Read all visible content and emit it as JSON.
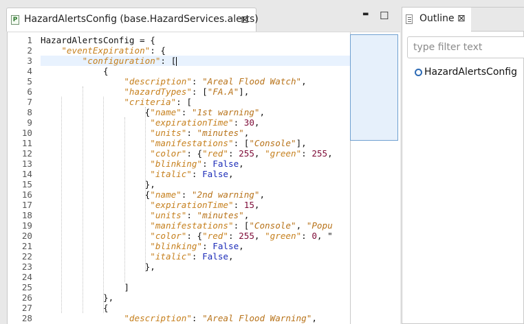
{
  "editor": {
    "tab_title": "HazardAlertsConfig (base.HazardServices.alerts)",
    "tab_close_glyph": "⊠",
    "file_icon_letter": "P",
    "minimize_glyph": "▬",
    "maximize_glyph": "☐",
    "current_line": 3,
    "lines": [
      {
        "num": "1",
        "parts": [
          [
            "p",
            "HazardAlertsConfig = {"
          ]
        ]
      },
      {
        "num": "2",
        "parts": [
          [
            "p",
            "    "
          ],
          [
            "k",
            "\"eventExpiration\""
          ],
          [
            "p",
            ": {"
          ]
        ]
      },
      {
        "num": "3",
        "parts": [
          [
            "p",
            "        "
          ],
          [
            "k",
            "\"configuration\""
          ],
          [
            "p",
            ": ["
          ]
        ]
      },
      {
        "num": "4",
        "parts": [
          [
            "p",
            "            {"
          ]
        ]
      },
      {
        "num": "5",
        "parts": [
          [
            "p",
            "                "
          ],
          [
            "k",
            "\"description\""
          ],
          [
            "p",
            ": "
          ],
          [
            "s",
            "\"Areal Flood Watch\""
          ],
          [
            "p",
            ","
          ]
        ]
      },
      {
        "num": "6",
        "parts": [
          [
            "p",
            "                "
          ],
          [
            "k",
            "\"hazardTypes\""
          ],
          [
            "p",
            ": ["
          ],
          [
            "s",
            "\"FA.A\""
          ],
          [
            "p",
            "],"
          ]
        ]
      },
      {
        "num": "7",
        "parts": [
          [
            "p",
            "                "
          ],
          [
            "k",
            "\"criteria\""
          ],
          [
            "p",
            ": ["
          ]
        ]
      },
      {
        "num": "8",
        "parts": [
          [
            "p",
            "                    {"
          ],
          [
            "k",
            "\"name\""
          ],
          [
            "p",
            ": "
          ],
          [
            "s",
            "\"1st warning\""
          ],
          [
            "p",
            ","
          ]
        ]
      },
      {
        "num": "9",
        "parts": [
          [
            "p",
            "                     "
          ],
          [
            "k",
            "\"expirationTime\""
          ],
          [
            "p",
            ": "
          ],
          [
            "n",
            "30"
          ],
          [
            "p",
            ","
          ]
        ]
      },
      {
        "num": "10",
        "parts": [
          [
            "p",
            "                     "
          ],
          [
            "k",
            "\"units\""
          ],
          [
            "p",
            ": "
          ],
          [
            "s",
            "\"minutes\""
          ],
          [
            "p",
            ","
          ]
        ]
      },
      {
        "num": "11",
        "parts": [
          [
            "p",
            "                     "
          ],
          [
            "k",
            "\"manifestations\""
          ],
          [
            "p",
            ": ["
          ],
          [
            "s",
            "\"Console\""
          ],
          [
            "p",
            "],"
          ]
        ]
      },
      {
        "num": "12",
        "parts": [
          [
            "p",
            "                     "
          ],
          [
            "k",
            "\"color\""
          ],
          [
            "p",
            ": {"
          ],
          [
            "k",
            "\"red\""
          ],
          [
            "p",
            ": "
          ],
          [
            "n",
            "255"
          ],
          [
            "p",
            ", "
          ],
          [
            "k",
            "\"green\""
          ],
          [
            "p",
            ": "
          ],
          [
            "n",
            "255"
          ],
          [
            "p",
            ","
          ]
        ]
      },
      {
        "num": "13",
        "parts": [
          [
            "p",
            "                     "
          ],
          [
            "k",
            "\"blinking\""
          ],
          [
            "p",
            ": "
          ],
          [
            "b",
            "False"
          ],
          [
            "p",
            ","
          ]
        ]
      },
      {
        "num": "14",
        "parts": [
          [
            "p",
            "                     "
          ],
          [
            "k",
            "\"italic\""
          ],
          [
            "p",
            ": "
          ],
          [
            "b",
            "False"
          ],
          [
            "p",
            ","
          ]
        ]
      },
      {
        "num": "15",
        "parts": [
          [
            "p",
            "                    },"
          ]
        ]
      },
      {
        "num": "16",
        "parts": [
          [
            "p",
            "                    {"
          ],
          [
            "k",
            "\"name\""
          ],
          [
            "p",
            ": "
          ],
          [
            "s",
            "\"2nd warning\""
          ],
          [
            "p",
            ","
          ]
        ]
      },
      {
        "num": "17",
        "parts": [
          [
            "p",
            "                     "
          ],
          [
            "k",
            "\"expirationTime\""
          ],
          [
            "p",
            ": "
          ],
          [
            "n",
            "15"
          ],
          [
            "p",
            ","
          ]
        ]
      },
      {
        "num": "18",
        "parts": [
          [
            "p",
            "                     "
          ],
          [
            "k",
            "\"units\""
          ],
          [
            "p",
            ": "
          ],
          [
            "s",
            "\"minutes\""
          ],
          [
            "p",
            ","
          ]
        ]
      },
      {
        "num": "19",
        "parts": [
          [
            "p",
            "                     "
          ],
          [
            "k",
            "\"manifestations\""
          ],
          [
            "p",
            ": ["
          ],
          [
            "s",
            "\"Console\""
          ],
          [
            "p",
            ", "
          ],
          [
            "s",
            "\"Popu"
          ]
        ]
      },
      {
        "num": "20",
        "parts": [
          [
            "p",
            "                     "
          ],
          [
            "k",
            "\"color\""
          ],
          [
            "p",
            ": {"
          ],
          [
            "k",
            "\"red\""
          ],
          [
            "p",
            ": "
          ],
          [
            "n",
            "255"
          ],
          [
            "p",
            ", "
          ],
          [
            "k",
            "\"green\""
          ],
          [
            "p",
            ": "
          ],
          [
            "n",
            "0"
          ],
          [
            "p",
            ", \""
          ]
        ]
      },
      {
        "num": "21",
        "parts": [
          [
            "p",
            "                     "
          ],
          [
            "k",
            "\"blinking\""
          ],
          [
            "p",
            ": "
          ],
          [
            "b",
            "False"
          ],
          [
            "p",
            ","
          ]
        ]
      },
      {
        "num": "22",
        "parts": [
          [
            "p",
            "                     "
          ],
          [
            "k",
            "\"italic\""
          ],
          [
            "p",
            ": "
          ],
          [
            "b",
            "False"
          ],
          [
            "p",
            ","
          ]
        ]
      },
      {
        "num": "23",
        "parts": [
          [
            "p",
            "                    },"
          ]
        ]
      },
      {
        "num": "24",
        "parts": [
          [
            "p",
            ""
          ]
        ]
      },
      {
        "num": "25",
        "parts": [
          [
            "p",
            "                ]"
          ]
        ]
      },
      {
        "num": "26",
        "parts": [
          [
            "p",
            "            },"
          ]
        ]
      },
      {
        "num": "27",
        "parts": [
          [
            "p",
            "            {"
          ]
        ]
      },
      {
        "num": "28",
        "parts": [
          [
            "p",
            "                "
          ],
          [
            "k",
            "\"description\""
          ],
          [
            "p",
            ": "
          ],
          [
            "s",
            "\"Areal Flood Warning\""
          ],
          [
            "p",
            ","
          ]
        ]
      }
    ]
  },
  "outline": {
    "tab_title": "Outline",
    "tab_close_glyph": "⊠",
    "filter_placeholder": "type filter text",
    "filter_value": "",
    "items": [
      "HazardAlertsConfig"
    ]
  },
  "colors": {
    "key": "#c6801e",
    "string": "#b8731a",
    "number": "#7d0a36",
    "builtin": "#1c2cb8",
    "current_line_bg": "#e8f2fe"
  }
}
